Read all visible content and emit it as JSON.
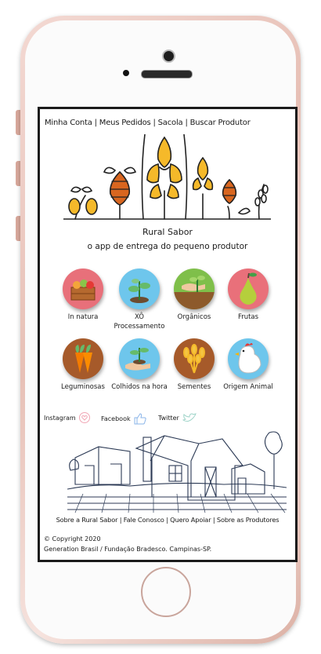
{
  "nav": {
    "text": "Minha Conta | Meus Pedidos | Sacola | Buscar Produtor"
  },
  "brand": {
    "title": "Rural Sabor",
    "subtitle": "o app de entrega do pequeno produtor"
  },
  "categories": [
    {
      "label": "In natura",
      "icon": "fruit-crate-icon",
      "color": "#e8707a"
    },
    {
      "label": "XÔ Processamento",
      "icon": "sprout-icon",
      "color": "#6ec6ec"
    },
    {
      "label": "Orgânicos",
      "icon": "hand-seedling-icon",
      "color": "#7fbf4a"
    },
    {
      "label": "Frutas",
      "icon": "pear-icon",
      "color": "#e9707a"
    },
    {
      "label": "Leguminosas",
      "icon": "carrot-icon",
      "color": "#a65a2a"
    },
    {
      "label": "Colhidos na hora",
      "icon": "hand-plant-icon",
      "color": "#6ec6ec"
    },
    {
      "label": "Sementes",
      "icon": "wheat-icon",
      "color": "#a65a2a"
    },
    {
      "label": "Origem Animal",
      "icon": "chicken-icon",
      "color": "#6ec6ec"
    }
  ],
  "social": {
    "instagram": "Instagram",
    "facebook": "Facebook",
    "twitter": "Twitter"
  },
  "footer": {
    "links": "Sobre a Rural Sabor | Fale Conosco | Quero Apoiar | Sobre as Produtores",
    "copyright": "© Copyright 2020",
    "credits": "Generation Brasil / Fundação Bradesco. Campinas-SP."
  },
  "colors": {
    "screen_border": "#1b1b1b",
    "phone_frame": "#e7c0b6",
    "wheat": "#f5b92a",
    "hops": "#d9661f"
  }
}
